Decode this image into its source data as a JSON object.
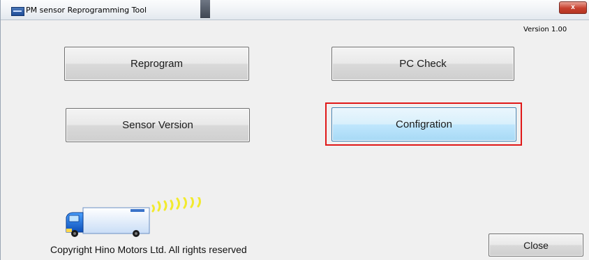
{
  "window": {
    "title": "PM sensor Reprogramming Tool",
    "close_glyph": "x"
  },
  "version_label": "Version 1.00",
  "buttons": {
    "reprogram": "Reprogram",
    "pc_check": "PC Check",
    "sensor_version": "Sensor Version",
    "configuration": "Configration",
    "close": "Close"
  },
  "footer": {
    "copyright": "Copyright Hino Motors Ltd. All rights reserved"
  },
  "icons": {
    "app": "app-window-icon",
    "truck": "truck-icon",
    "signal": "signal-waves-icon"
  },
  "colors": {
    "highlight": "#e01818",
    "focused_button": "#bee6fd",
    "truck_cab": "#1f6fd6",
    "signal": "#f2ea2e"
  }
}
